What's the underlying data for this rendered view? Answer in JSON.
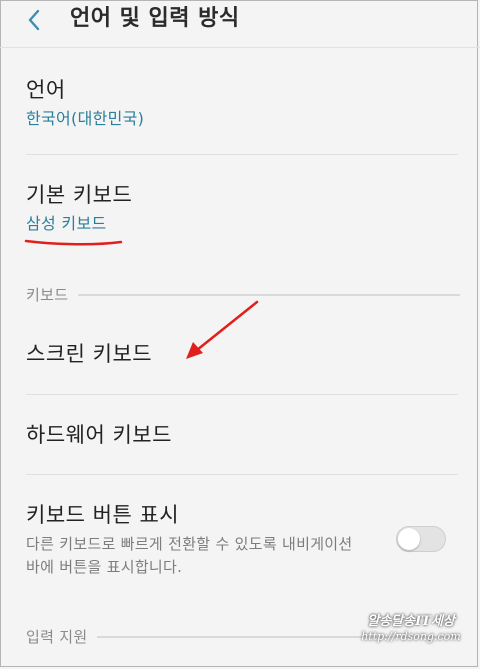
{
  "header": {
    "back_icon": "chevron-left-icon",
    "title": "언어 및 입력 방식"
  },
  "settings": {
    "language": {
      "title": "언어",
      "value": "한국어(대한민국)"
    },
    "default_keyboard": {
      "title": "기본 키보드",
      "value": "삼성 키보드"
    },
    "keyboard_section_label": "키보드",
    "screen_keyboard": {
      "title": "스크린 키보드"
    },
    "hardware_keyboard": {
      "title": "하드웨어 키보드"
    },
    "keyboard_button": {
      "title": "키보드 버튼 표시",
      "description": "다른 키보드로 빠르게 전환할 수 있도록 내비게이션 바에 버튼을 표시합니다.",
      "toggle_on": false
    },
    "input_assist_section_label": "입력 지원"
  },
  "watermark": {
    "line1": "알송달송IT세상",
    "line2": "http://rdsong.com"
  },
  "colors": {
    "accent_text": "#2a7f9c",
    "annotation_red": "#e0201c",
    "background": "#f4f4f4"
  }
}
